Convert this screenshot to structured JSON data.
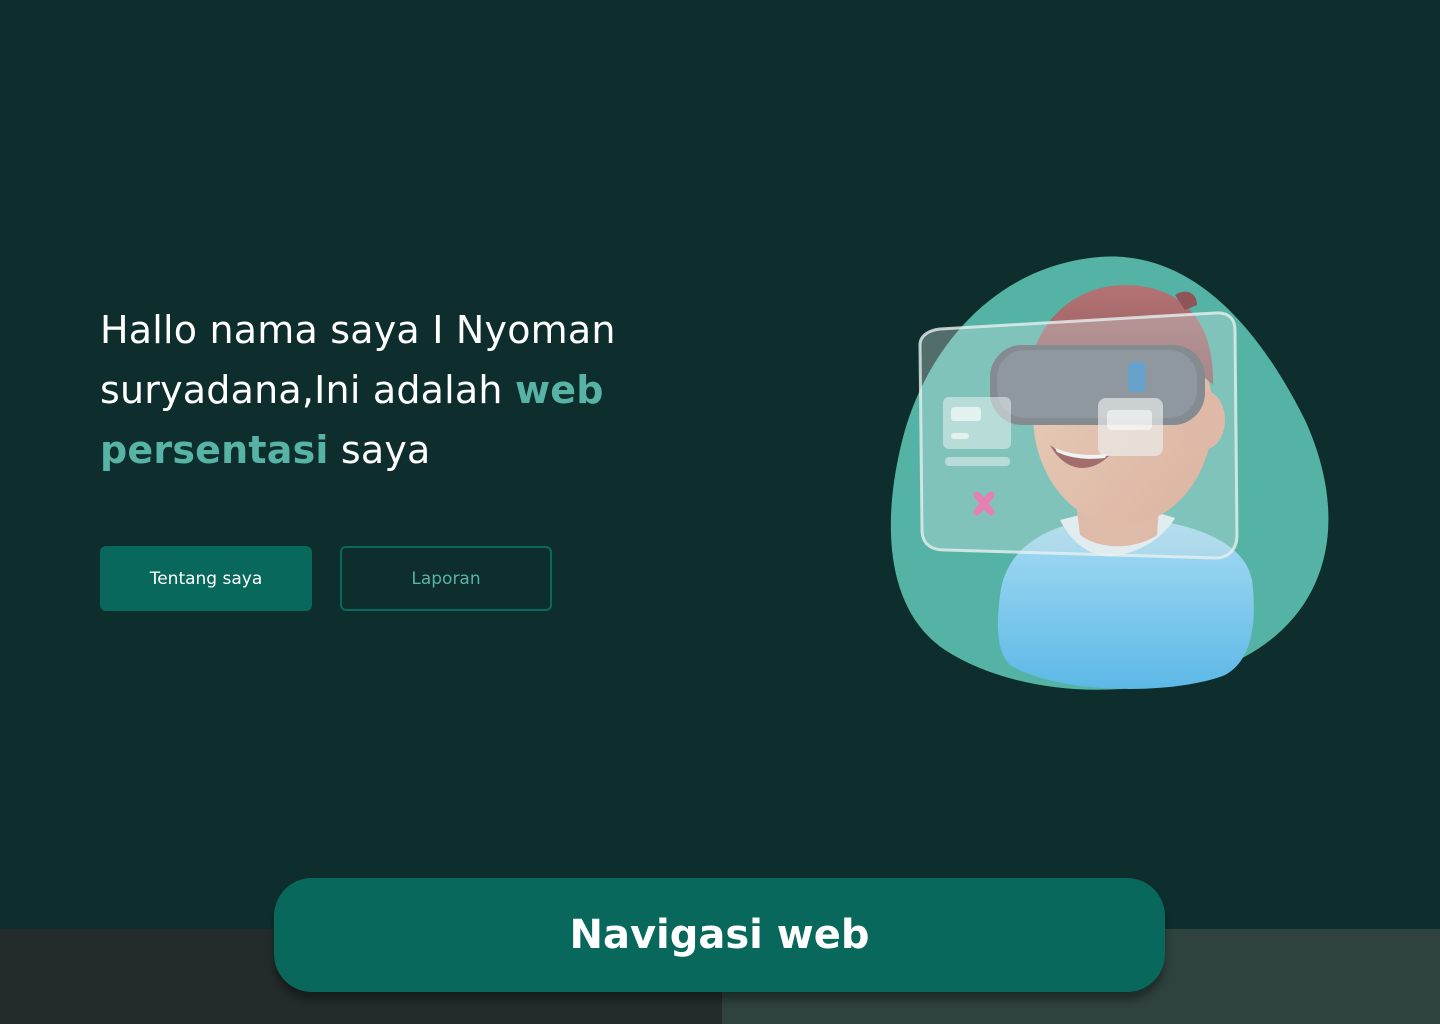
{
  "hero": {
    "line1": "Hallo nama saya I Nyoman",
    "line2_plain": "suryadana,Ini adalah ",
    "line2_accent": "web",
    "line3_accent": "persentasi",
    "line3_plain": " saya"
  },
  "buttons": {
    "primary_label": "Tentang saya",
    "secondary_label": "Laporan"
  },
  "nav": {
    "label": "Navigasi web"
  },
  "colors": {
    "background": "#0e2e2d",
    "accent": "#57b3a6",
    "primary": "#08685b",
    "blob": "#55b3a6"
  },
  "illustration": {
    "icon": "vr-avatar-illustration"
  }
}
